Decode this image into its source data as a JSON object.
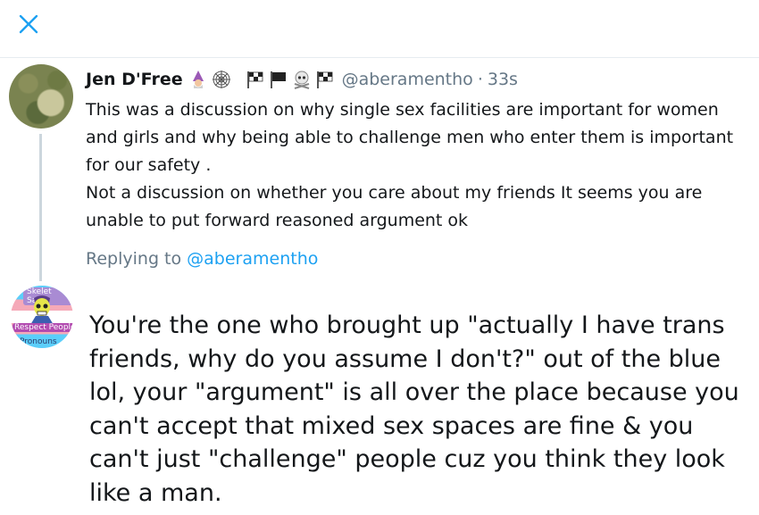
{
  "colors": {
    "accent": "#1da1f2",
    "secondary_text": "#657786",
    "divider": "#e6ecf0",
    "thread_line": "#ccd6dd"
  },
  "topbar": {
    "close_icon": "close-icon"
  },
  "tweet": {
    "name": "Jen D'Free",
    "emojis": [
      "mage-emoji",
      "spider-web-emoji",
      "chequered-flag-emoji",
      "black-flag-emoji",
      "skull-crossbones-emoji",
      "chequered-flag-emoji"
    ],
    "handle": "@aberamentho",
    "separator": "·",
    "time": "33s",
    "lines": [
      "This was a discussion on why single sex facilities are important for women and girls and why being able to challenge men who enter them is important for our safety .",
      "Not a discussion on whether you care about my friends It seems you are unable to put forward reasoned argument ok"
    ]
  },
  "replying": {
    "prefix": "Replying to ",
    "handle": "@aberamentho"
  },
  "reply_avatar": {
    "badge_top": "Skelet Says",
    "badge_mid": "Respect Peoples",
    "badge_bottom": "Pronouns"
  },
  "reply": {
    "text": "You're the one who brought up \"actually I have trans friends, why do you assume I don't?\" out of the blue lol, your \"argument\" is all over the place because you can't accept that mixed sex spaces are fine & you can't just \"challenge\" people cuz you think they look like a man."
  }
}
